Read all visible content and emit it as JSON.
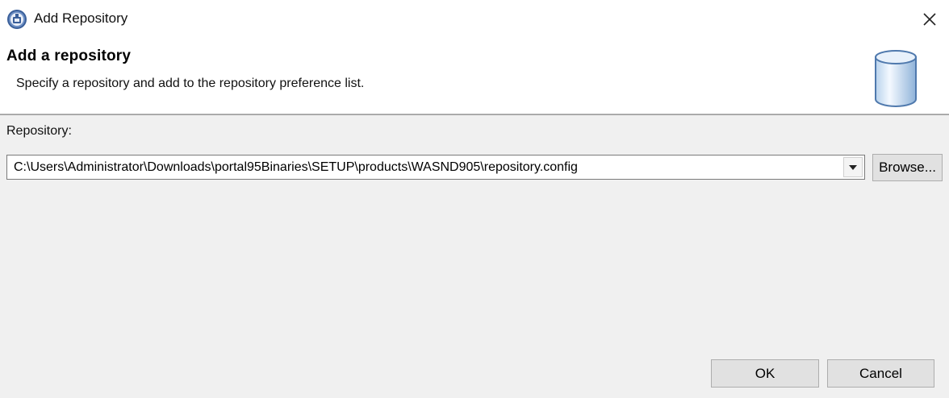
{
  "window": {
    "title": "Add Repository",
    "icon": "installation-manager-icon",
    "close_icon": "close-icon"
  },
  "header": {
    "title": "Add a repository",
    "description": "Specify a repository and add to the repository preference list.",
    "graphic": "repository-cylinder-icon"
  },
  "form": {
    "repository_label": "Repository:",
    "repository_value": "C:\\Users\\Administrator\\Downloads\\portal95Binaries\\SETUP\\products\\WASND905\\repository.config",
    "browse_label": "Browse..."
  },
  "footer": {
    "ok_label": "OK",
    "cancel_label": "Cancel"
  }
}
